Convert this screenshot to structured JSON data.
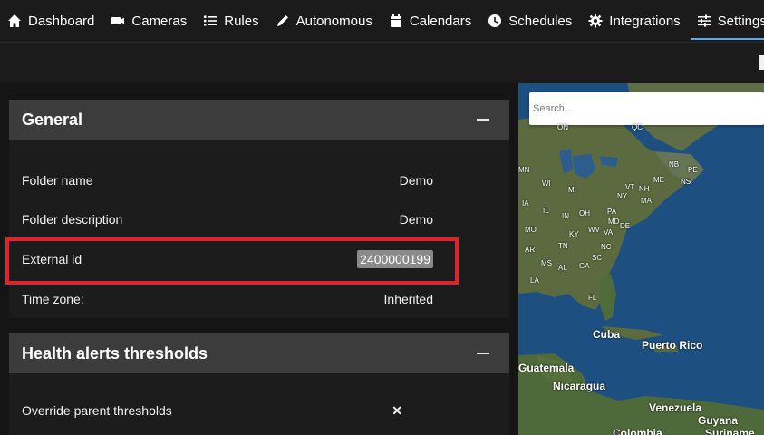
{
  "nav": {
    "items": [
      {
        "label": "Dashboard",
        "icon": "home-icon"
      },
      {
        "label": "Cameras",
        "icon": "video-camera-icon"
      },
      {
        "label": "Rules",
        "icon": "list-icon"
      },
      {
        "label": "Autonomous",
        "icon": "pencil-icon"
      },
      {
        "label": "Calendars",
        "icon": "calendar-icon"
      },
      {
        "label": "Schedules",
        "icon": "clock-icon"
      },
      {
        "label": "Integrations",
        "icon": "gear-icon"
      },
      {
        "label": "Settings",
        "icon": "sliders-icon"
      }
    ],
    "active": "Settings"
  },
  "general": {
    "title": "General",
    "rows": [
      {
        "label": "Folder name",
        "value": "Demo"
      },
      {
        "label": "Folder description",
        "value": "Demo"
      },
      {
        "label": "External id",
        "value": "2400000199"
      },
      {
        "label": "Time zone:",
        "value": "Inherited"
      }
    ]
  },
  "health": {
    "title": "Health alerts thresholds",
    "rows": [
      {
        "label": "Override parent thresholds",
        "value": "✕"
      }
    ]
  },
  "map": {
    "search_placeholder": "Search...",
    "labels": [
      "ON",
      "QC",
      "NB",
      "PE",
      "ME",
      "NS",
      "NH",
      "VT",
      "NY",
      "MA",
      "MN",
      "WI",
      "MI",
      "IA",
      "IL",
      "IN",
      "OH",
      "PA",
      "MD",
      "DE",
      "MO",
      "KY",
      "WV",
      "VA",
      "NC",
      "AR",
      "TN",
      "SC",
      "MS",
      "AL",
      "GA",
      "LA",
      "FL",
      "Cuba",
      "Puerto Rico",
      "Guatemala",
      "Nicaragua",
      "Venezuela",
      "Guyana",
      "Colombia",
      "Suriname"
    ]
  },
  "colors": {
    "accent": "#5aa9e6",
    "highlight": "#e0232a",
    "panel_header": "#3c3c3c"
  }
}
